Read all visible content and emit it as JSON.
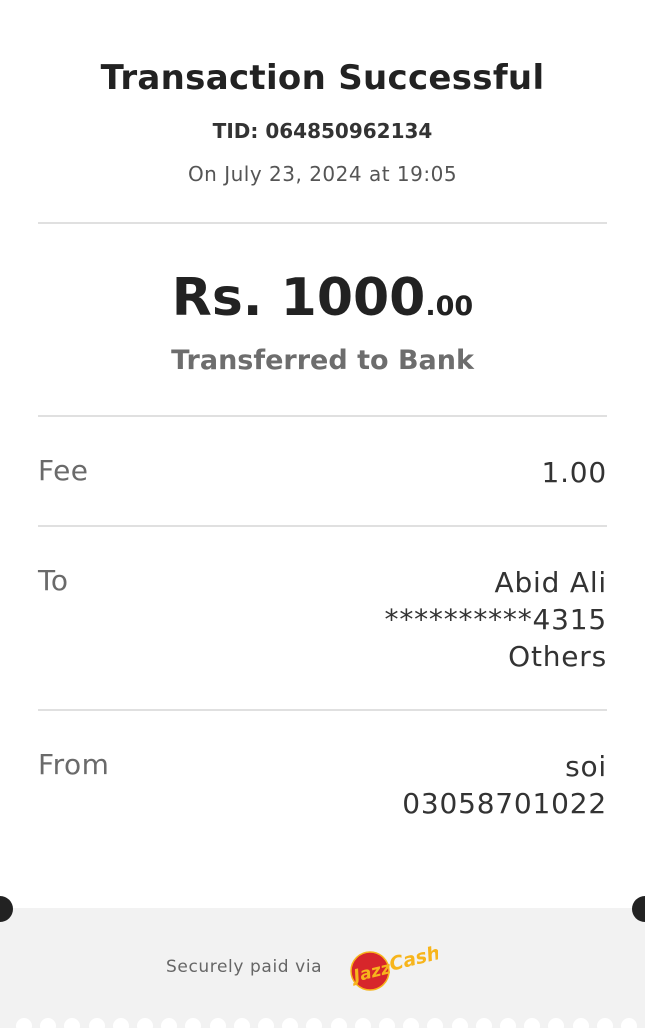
{
  "receipt": {
    "title": "Transaction Successful",
    "tid": "TID: 064850962134",
    "datetime": "On July 23, 2024 at 19:05",
    "amount_main": "Rs. 1000",
    "amount_decimal": ".00",
    "status": "Transferred to Bank"
  },
  "details": {
    "fee_label": "Fee",
    "fee_value": "1.00",
    "to_label": "To",
    "to_name": "Abid Ali",
    "to_account": "**********4315",
    "to_bank": "Others",
    "from_label": "From",
    "from_name": "soi",
    "from_number": "03058701022"
  },
  "footer": {
    "secure_text": "Securely paid via",
    "logo_icon": "jazzcash-logo",
    "logo_text": "JazzCash"
  },
  "colors": {
    "jazz_red": "#d7262b",
    "cash_orange": "#f7b51c",
    "divider": "#e0e0e0",
    "footer_bg": "#f2f2f2"
  }
}
